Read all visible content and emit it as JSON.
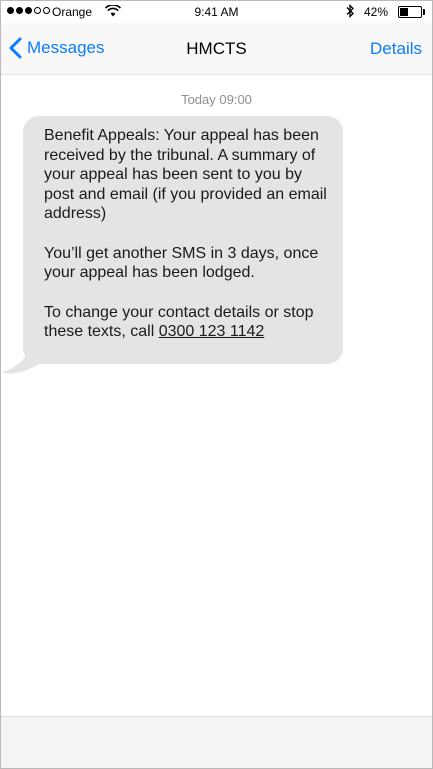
{
  "status_bar": {
    "carrier": "Orange",
    "time": "9:41 AM",
    "battery_percent": "42%",
    "battery_level": 0.42,
    "signal_bars_filled": 3,
    "signal_bars_total": 5
  },
  "nav": {
    "back_label": "Messages",
    "title": "HMCTS",
    "details_label": "Details"
  },
  "conversation": {
    "timestamp": "Today 09:00",
    "message": {
      "para1": "Benefit Appeals: Your appeal has been received by the tribunal. A summary of your appeal has been sent to you by post and email (if you provided an email address)",
      "para2": "You’ll get another SMS in 3 days, once your appeal has been lodged.",
      "para3_prefix": "To change your contact details or stop these texts, call ",
      "phone_number": "0300 123 1142"
    }
  },
  "colors": {
    "accent": "#0a7cff",
    "bubble": "#e4e4e6",
    "timestamp": "#8e8e93"
  },
  "icons": {
    "back": "chevron-left-icon",
    "wifi": "wifi-icon",
    "bluetooth": "bluetooth-icon",
    "battery": "battery-icon"
  }
}
